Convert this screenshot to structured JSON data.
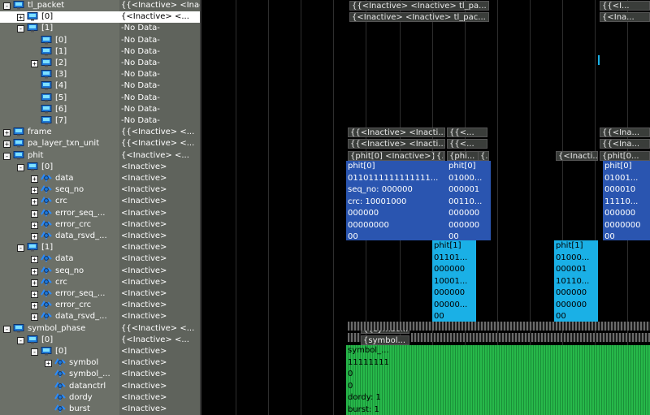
{
  "colors": {
    "tree_bg": "#6c7068",
    "values_bg": "#5f635c",
    "wave_bg": "#000000",
    "blue_box": "#2a55b0",
    "cyan_box": "#1ab0e6",
    "green_box": "#27b84a",
    "selection": "#ffffff"
  },
  "tree": [
    {
      "label": "tl_packet",
      "depth": 0,
      "toggle": "-",
      "icon": "signal-group-icon",
      "value": "{{<Inactive> <Inactive> ..."
    },
    {
      "label": "[0]",
      "depth": 1,
      "toggle": "+",
      "icon": "signal-group-icon",
      "value": "{<Inactive> <...",
      "selected": true
    },
    {
      "label": "[1]",
      "depth": 1,
      "toggle": "-",
      "icon": "signal-group-icon",
      "value": "-No Data-"
    },
    {
      "label": "[0]",
      "depth": 2,
      "toggle": "",
      "icon": "signal-group-icon",
      "value": "-No Data-"
    },
    {
      "label": "[1]",
      "depth": 2,
      "toggle": "",
      "icon": "signal-group-icon",
      "value": "-No Data-"
    },
    {
      "label": "[2]",
      "depth": 2,
      "toggle": "+",
      "icon": "signal-group-icon",
      "value": "-No Data-"
    },
    {
      "label": "[3]",
      "depth": 2,
      "toggle": "",
      "icon": "signal-group-icon",
      "value": "-No Data-"
    },
    {
      "label": "[4]",
      "depth": 2,
      "toggle": "",
      "icon": "signal-group-icon",
      "value": "-No Data-"
    },
    {
      "label": "[5]",
      "depth": 2,
      "toggle": "",
      "icon": "signal-group-icon",
      "value": "-No Data-"
    },
    {
      "label": "[6]",
      "depth": 2,
      "toggle": "",
      "icon": "signal-group-icon",
      "value": "-No Data-"
    },
    {
      "label": "[7]",
      "depth": 2,
      "toggle": "",
      "icon": "signal-group-icon",
      "value": "-No Data-"
    },
    {
      "label": "frame",
      "depth": 0,
      "toggle": "+",
      "icon": "signal-group-icon",
      "value": "{{<Inactive> <..."
    },
    {
      "label": "pa_layer_txn_unit",
      "depth": 0,
      "toggle": "+",
      "icon": "signal-group-icon",
      "value": "{{<Inactive> <..."
    },
    {
      "label": "phit",
      "depth": 0,
      "toggle": "-",
      "icon": "signal-group-icon",
      "value": "{<Inactive> <..."
    },
    {
      "label": "[0]",
      "depth": 1,
      "toggle": "-",
      "icon": "signal-group-icon",
      "value": "<Inactive>"
    },
    {
      "label": "data",
      "depth": 2,
      "toggle": "+",
      "icon": "signal-field-icon",
      "value": "<Inactive>"
    },
    {
      "label": "seq_no",
      "depth": 2,
      "toggle": "+",
      "icon": "signal-field-icon",
      "value": "<Inactive>"
    },
    {
      "label": "crc",
      "depth": 2,
      "toggle": "+",
      "icon": "signal-field-icon",
      "value": "<Inactive>"
    },
    {
      "label": "error_seq_...",
      "depth": 2,
      "toggle": "+",
      "icon": "signal-field-icon",
      "value": "<Inactive>"
    },
    {
      "label": "error_crc",
      "depth": 2,
      "toggle": "+",
      "icon": "signal-field-icon",
      "value": "<Inactive>"
    },
    {
      "label": "data_rsvd_...",
      "depth": 2,
      "toggle": "+",
      "icon": "signal-field-icon",
      "value": "<Inactive>"
    },
    {
      "label": "[1]",
      "depth": 1,
      "toggle": "-",
      "icon": "signal-group-icon",
      "value": "<Inactive>"
    },
    {
      "label": "data",
      "depth": 2,
      "toggle": "+",
      "icon": "signal-field-icon",
      "value": "<Inactive>"
    },
    {
      "label": "seq_no",
      "depth": 2,
      "toggle": "+",
      "icon": "signal-field-icon",
      "value": "<Inactive>"
    },
    {
      "label": "crc",
      "depth": 2,
      "toggle": "+",
      "icon": "signal-field-icon",
      "value": "<Inactive>"
    },
    {
      "label": "error_seq_...",
      "depth": 2,
      "toggle": "+",
      "icon": "signal-field-icon",
      "value": "<Inactive>"
    },
    {
      "label": "error_crc",
      "depth": 2,
      "toggle": "+",
      "icon": "signal-field-icon",
      "value": "<Inactive>"
    },
    {
      "label": "data_rsvd_...",
      "depth": 2,
      "toggle": "+",
      "icon": "signal-field-icon",
      "value": "<Inactive>"
    },
    {
      "label": "symbol_phase",
      "depth": 0,
      "toggle": "-",
      "icon": "signal-group-icon",
      "value": "{{<Inactive> <..."
    },
    {
      "label": "[0]",
      "depth": 1,
      "toggle": "-",
      "icon": "signal-group-icon",
      "value": "{<Inactive> <..."
    },
    {
      "label": "[0]",
      "depth": 2,
      "toggle": "-",
      "icon": "signal-group-icon",
      "value": "<Inactive>"
    },
    {
      "label": "symbol",
      "depth": 3,
      "toggle": "+",
      "icon": "signal-field-icon",
      "value": "<Inactive>"
    },
    {
      "label": "symbol_...",
      "depth": 3,
      "toggle": "",
      "icon": "signal-field-icon",
      "value": "<Inactive>"
    },
    {
      "label": "datanctrl",
      "depth": 3,
      "toggle": "",
      "icon": "signal-field-icon",
      "value": "<Inactive>"
    },
    {
      "label": "dordy",
      "depth": 3,
      "toggle": "",
      "icon": "signal-field-icon",
      "value": "<Inactive>"
    },
    {
      "label": "burst",
      "depth": 3,
      "toggle": "",
      "icon": "signal-field-icon",
      "value": "<Inactive>"
    }
  ],
  "wave": {
    "bars": [
      {
        "row": 0,
        "col": "a",
        "text": "{{<Inactive> <Inactive> tl_pa..."
      },
      {
        "row": 0,
        "col": "z",
        "text": "{{<I..."
      },
      {
        "row": 1,
        "col": "a",
        "text": "{<Inactive> <Inactive> tl_pac..."
      },
      {
        "row": 1,
        "col": "z",
        "text": "{<Ina..."
      },
      {
        "row": 11,
        "col": "b",
        "text": "{{<Inactive> <Inacti..."
      },
      {
        "row": 11,
        "col": "c",
        "text": "{{<..."
      },
      {
        "row": 11,
        "col": "z",
        "text": "{{<Ina..."
      },
      {
        "row": 12,
        "col": "b",
        "text": "{{<Inactive> <Inacti..."
      },
      {
        "row": 12,
        "col": "c",
        "text": "{{<..."
      },
      {
        "row": 12,
        "col": "z",
        "text": "{{<Ina..."
      },
      {
        "row": 13,
        "col": "b",
        "text": "{phit[0] <Inactive>}"
      },
      {
        "row": 13,
        "col": "c2",
        "text": "{..."
      },
      {
        "row": 13,
        "col": "c",
        "text": "{phi..."
      },
      {
        "row": 13,
        "col": "d",
        "text": "{..."
      },
      {
        "row": 13,
        "col": "y",
        "text": "{<Inacti..."
      },
      {
        "row": 13,
        "col": "z",
        "text": "{phit[0..."
      },
      {
        "row": 28,
        "col": "g",
        "text": "{{symbol..."
      },
      {
        "row": 29,
        "col": "g",
        "text": "{symbol..."
      }
    ],
    "blue_main": [
      "phit[0]",
      "0110111111111111...",
      "seq_no: 000000",
      "crc: 10001000",
      "000000",
      "00000000",
      "00"
    ],
    "blue_mid": [
      "phit[0]",
      "01000...",
      "000001",
      "00110...",
      "000000",
      "000000",
      "00"
    ],
    "blue_right": [
      "phit[0]",
      "01001...",
      "000010",
      "11110...",
      "000000",
      "0000000",
      "00"
    ],
    "cyan_left": [
      "phit[1]",
      "01101...",
      "000000",
      "10001...",
      "000000",
      "00000...",
      "00"
    ],
    "cyan_right": [
      "phit[1]",
      "01000...",
      "000001",
      "10110...",
      "000000",
      "000000",
      "00"
    ],
    "green": [
      "symbol_...",
      "11111111",
      "0",
      "0",
      "dordy: 1",
      "burst: 1"
    ]
  }
}
